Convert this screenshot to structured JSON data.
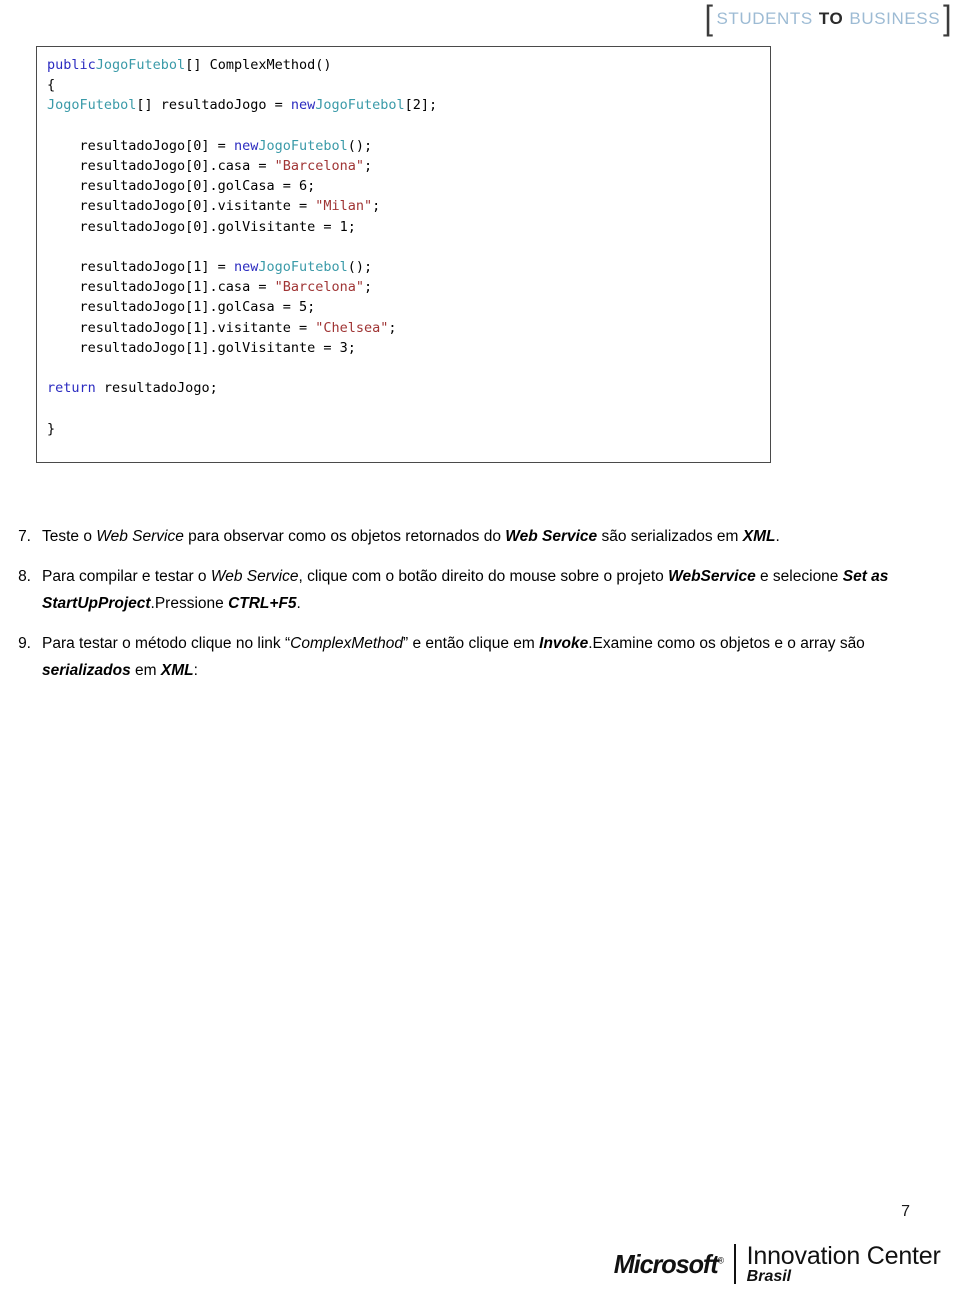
{
  "header": {
    "logo": {
      "open_bracket": "[",
      "close_bracket": "]",
      "word1": "STUDENTS",
      "word2": "TO",
      "word3": "BUSINESS",
      "color_light": "#9dbbd4",
      "color_dark": "#2b2b2b"
    }
  },
  "code_block": {
    "language": "csharp",
    "colors": {
      "keyword": "#2b2bc0",
      "type": "#3a9aa8",
      "string": "#a03535",
      "plain": "#000000",
      "border": "#4a4a4a"
    },
    "lines": [
      [
        {
          "t": "public",
          "c": "kw"
        },
        {
          "t": "JogoFutebol",
          "c": "typ"
        },
        {
          "t": "[] ComplexMethod()",
          "c": "pln"
        }
      ],
      [
        {
          "t": "{",
          "c": "pln"
        }
      ],
      [
        {
          "t": "JogoFutebol",
          "c": "typ"
        },
        {
          "t": "[] resultadoJogo = ",
          "c": "pln"
        },
        {
          "t": "new",
          "c": "kw"
        },
        {
          "t": "JogoFutebol",
          "c": "typ"
        },
        {
          "t": "[2];",
          "c": "pln"
        }
      ],
      [
        {
          "t": "",
          "c": "pln"
        }
      ],
      [
        {
          "t": "    resultadoJogo[0] = ",
          "c": "pln"
        },
        {
          "t": "new",
          "c": "kw"
        },
        {
          "t": "JogoFutebol",
          "c": "typ"
        },
        {
          "t": "();",
          "c": "pln"
        }
      ],
      [
        {
          "t": "    resultadoJogo[0].casa = ",
          "c": "pln"
        },
        {
          "t": "\"Barcelona\"",
          "c": "str"
        },
        {
          "t": ";",
          "c": "pln"
        }
      ],
      [
        {
          "t": "    resultadoJogo[0].golCasa = 6;",
          "c": "pln"
        }
      ],
      [
        {
          "t": "    resultadoJogo[0].visitante = ",
          "c": "pln"
        },
        {
          "t": "\"Milan\"",
          "c": "str"
        },
        {
          "t": ";",
          "c": "pln"
        }
      ],
      [
        {
          "t": "    resultadoJogo[0].golVisitante = 1;",
          "c": "pln"
        }
      ],
      [
        {
          "t": "",
          "c": "pln"
        }
      ],
      [
        {
          "t": "    resultadoJogo[1] = ",
          "c": "pln"
        },
        {
          "t": "new",
          "c": "kw"
        },
        {
          "t": "JogoFutebol",
          "c": "typ"
        },
        {
          "t": "();",
          "c": "pln"
        }
      ],
      [
        {
          "t": "    resultadoJogo[1].casa = ",
          "c": "pln"
        },
        {
          "t": "\"Barcelona\"",
          "c": "str"
        },
        {
          "t": ";",
          "c": "pln"
        }
      ],
      [
        {
          "t": "    resultadoJogo[1].golCasa = 5;",
          "c": "pln"
        }
      ],
      [
        {
          "t": "    resultadoJogo[1].visitante = ",
          "c": "pln"
        },
        {
          "t": "\"Chelsea\"",
          "c": "str"
        },
        {
          "t": ";",
          "c": "pln"
        }
      ],
      [
        {
          "t": "    resultadoJogo[1].golVisitante = 3;",
          "c": "pln"
        }
      ],
      [
        {
          "t": "",
          "c": "pln"
        }
      ],
      [
        {
          "t": "return",
          "c": "kw"
        },
        {
          "t": " resultadoJogo;",
          "c": "pln"
        }
      ],
      [
        {
          "t": "",
          "c": "pln"
        }
      ],
      [
        {
          "t": "}",
          "c": "pln"
        }
      ]
    ]
  },
  "steps": [
    {
      "number": "7.",
      "runs": [
        {
          "t": "Teste o ",
          "s": "n"
        },
        {
          "t": "Web Service",
          "s": "i"
        },
        {
          "t": " para observar como os objetos retornados do ",
          "s": "n"
        },
        {
          "t": "Web Service",
          "s": "bi"
        },
        {
          "t": " são serializados em ",
          "s": "n"
        },
        {
          "t": "XML",
          "s": "bi"
        },
        {
          "t": ".",
          "s": "n"
        }
      ]
    },
    {
      "number": "8.",
      "runs": [
        {
          "t": "Para compilar e testar o ",
          "s": "n"
        },
        {
          "t": "Web Service",
          "s": "i"
        },
        {
          "t": ", clique com o botão direito do mouse sobre o projeto ",
          "s": "n"
        },
        {
          "t": "WebService",
          "s": "bi"
        },
        {
          "t": " e selecione ",
          "s": "n"
        },
        {
          "t": "Set as StartUpProject",
          "s": "bi"
        },
        {
          "t": ".Pressione ",
          "s": "n"
        },
        {
          "t": "CTRL+F5",
          "s": "bi"
        },
        {
          "t": ".",
          "s": "n"
        }
      ]
    },
    {
      "number": "9.",
      "runs": [
        {
          "t": "Para testar o método clique no link “",
          "s": "n"
        },
        {
          "t": "ComplexMethod",
          "s": "i"
        },
        {
          "t": "” e então clique em ",
          "s": "n"
        },
        {
          "t": "Invoke",
          "s": "bi"
        },
        {
          "t": ".Examine como os objetos e o array são ",
          "s": "n"
        },
        {
          "t": "serializados",
          "s": "bi"
        },
        {
          "t": " em ",
          "s": "n"
        },
        {
          "t": "XML",
          "s": "bi"
        },
        {
          "t": ":",
          "s": "n"
        }
      ]
    }
  ],
  "page_number": "7",
  "footer": {
    "microsoft": "Microsoft",
    "registered_mark": "®",
    "innovation_center": "Innovation Center",
    "brasil": "Brasil"
  }
}
